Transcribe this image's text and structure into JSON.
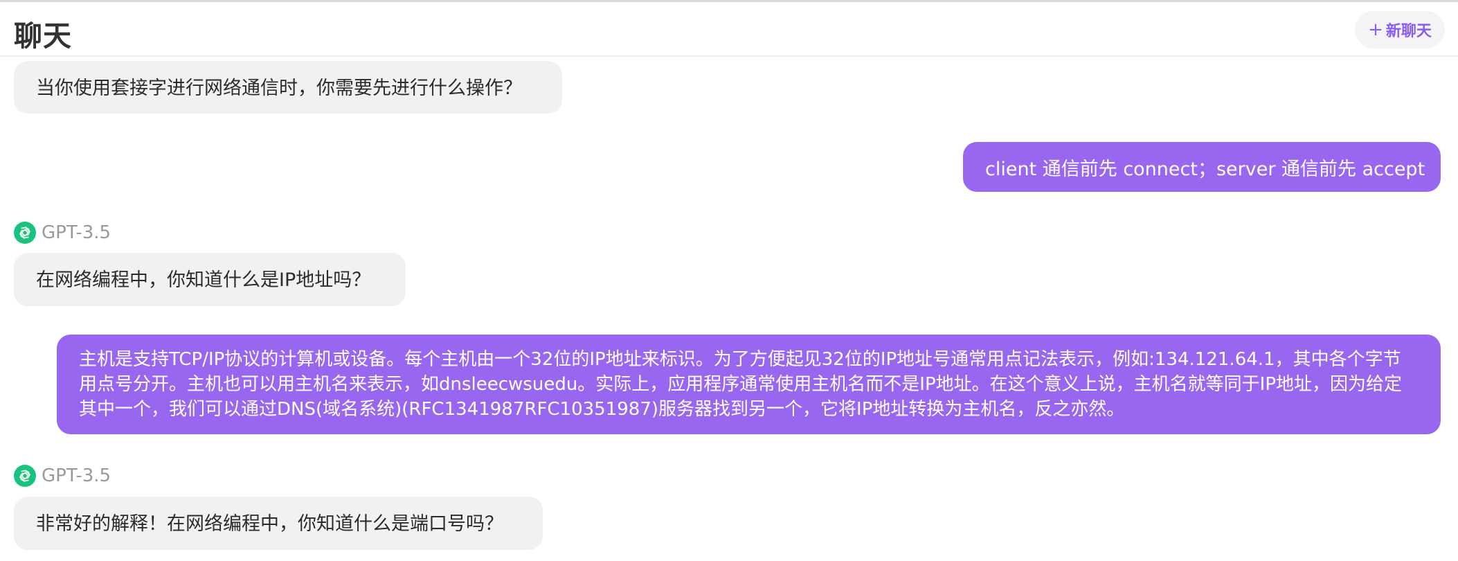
{
  "header": {
    "title": "聊天",
    "new_chat_label": "新聊天",
    "new_chat_icon": "plus-icon"
  },
  "colors": {
    "accent": "#9966f0",
    "bot_bubble": "#f1f1f3",
    "model_icon": "#19c37d"
  },
  "messages": [
    {
      "role": "bot",
      "text": "当你使用套接字进行网络通信时，你需要先进行什么操作？"
    },
    {
      "role": "user",
      "text": "client 通信前先 connect；server 通信前先 accept"
    },
    {
      "role": "bot",
      "model": "GPT-3.5",
      "model_icon": "openai-icon",
      "text": "在网络编程中，你知道什么是IP地址吗？"
    },
    {
      "role": "user",
      "text": "主机是支持TCP/IP协议的计算机或设备。每个主机由一个32位的IP地址来标识。为了方便起见32位的IP地址号通常用点记法表示，例如:134.121.64.1，其中各个字节用点号分开。主机也可以用主机名来表示，如dnsleecwsuedu。实际上，应用程序通常使用主机名而不是IP地址。在这个意义上说，主机名就等同于IP地址，因为给定其中一个，我们可以通过DNS(域名系统)(RFC1341987RFC10351987)服务器找到另一个，它将IP地址转换为主机名，反之亦然。"
    },
    {
      "role": "bot",
      "model": "GPT-3.5",
      "model_icon": "openai-icon",
      "text": "非常好的解释！在网络编程中，你知道什么是端口号吗？"
    }
  ]
}
